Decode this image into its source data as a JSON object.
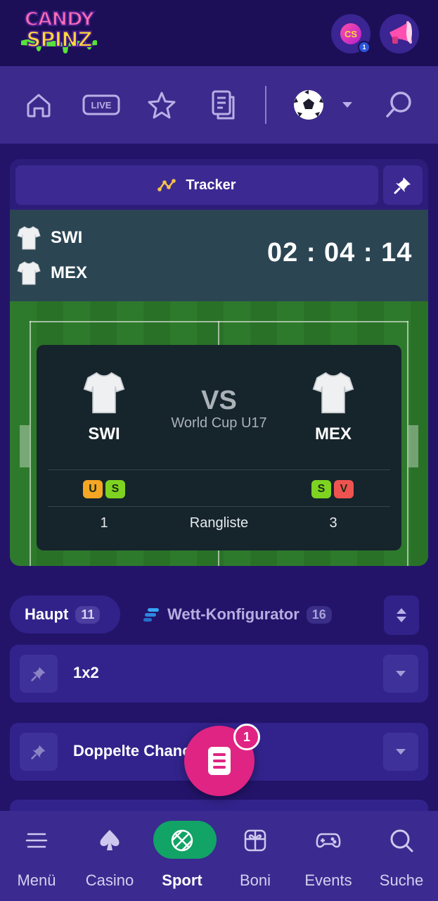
{
  "header": {
    "logo_line1": "CANDY",
    "logo_line2": "SPINZ",
    "avatar_initials": "CS",
    "avatar_badge": "1",
    "icons": [
      "avatar",
      "megaphone-icon"
    ]
  },
  "sport_nav": {
    "live_label": "LIVE",
    "icons": [
      "home-icon",
      "live-icon",
      "star-icon",
      "betslip-icon",
      "soccer-ball-icon",
      "chevron-down-icon",
      "search-icon"
    ]
  },
  "tracker": {
    "button_label": "Tracker",
    "home_team": "SWI",
    "away_team": "MEX",
    "clock": "02 : 04 : 14",
    "vs_label": "VS",
    "competition": "World Cup U17",
    "home_form": [
      "U",
      "S"
    ],
    "away_form": [
      "S",
      "V"
    ],
    "ranking_label": "Rangliste",
    "home_rank": "1",
    "away_rank": "3",
    "colors": {
      "form_U": "#f5a623",
      "form_S": "#7ed321",
      "form_V": "#ef5350",
      "pitch": "#2e7a2c",
      "panel": "#2b4553"
    }
  },
  "market_tabs": {
    "main_label": "Haupt",
    "main_count": "11",
    "config_label": "Wett-Konfigurator",
    "config_count": "16"
  },
  "markets": [
    {
      "title": "1x2"
    },
    {
      "title": "Doppelte Chance"
    }
  ],
  "betslip": {
    "count": "1"
  },
  "bottom_nav": {
    "items": [
      {
        "label": "Menü",
        "icon": "menu-icon"
      },
      {
        "label": "Casino",
        "icon": "spade-icon"
      },
      {
        "label": "Sport",
        "icon": "basketball-icon",
        "active": true
      },
      {
        "label": "Boni",
        "icon": "gift-icon"
      },
      {
        "label": "Events",
        "icon": "gamepad-icon"
      },
      {
        "label": "Suche",
        "icon": "search-icon"
      }
    ]
  },
  "theme": {
    "background": "#23146a",
    "accent": "#e02483",
    "active_green": "#12a366"
  }
}
